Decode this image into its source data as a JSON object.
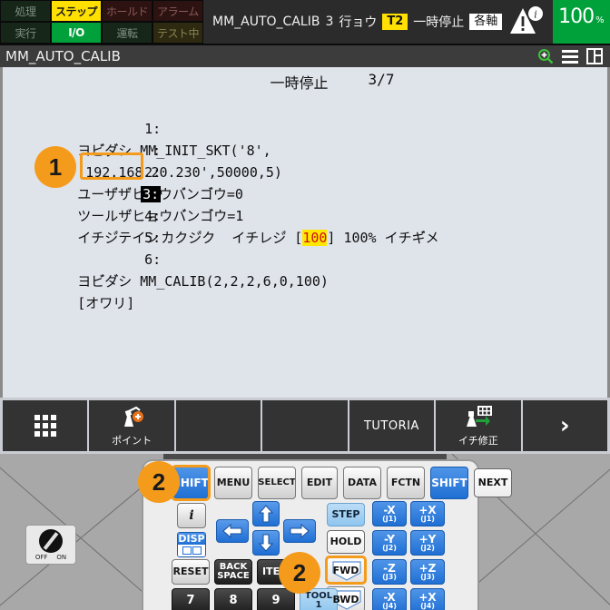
{
  "status_lights": [
    {
      "label": "処理",
      "state": "dim-green"
    },
    {
      "label": "ステップ",
      "state": "on-yellow"
    },
    {
      "label": "ホールド",
      "state": "dim-red"
    },
    {
      "label": "アラーム",
      "state": "dim-red"
    },
    {
      "label": "実行",
      "state": "dim-green"
    },
    {
      "label": "I/O",
      "state": "on-green"
    },
    {
      "label": "運転",
      "state": "dim-green"
    },
    {
      "label": "テスト中",
      "state": "dim-olive"
    }
  ],
  "statusbar": {
    "program_name": "MM_AUTO_CALIB",
    "line_number": "3",
    "line_unit": "行ョウ",
    "mode_tag": "T2",
    "run_state": "一時停止",
    "motion_type": "各軸",
    "warning_icon": "warning-info-icon",
    "override_value": "100",
    "override_unit": "%"
  },
  "titlebar": {
    "title": "MM_AUTO_CALIB",
    "icons": [
      "zoom-in-icon",
      "hamburger-menu-icon",
      "split-view-icon"
    ]
  },
  "program": {
    "run_state": "一時停止",
    "page_indicator": "3/7",
    "lines": [
      {
        "no": "1:",
        "text": "ヨビ゙ダ゙シ MM_INIT_SKT('8',"
      },
      {
        "no": ":",
        "text": "'192.168.20.230',50000,5)"
      },
      {
        "no": "2:",
        "text": "ユーザ゙ザ゙ヒョウバ゙ンゴ゙ウ=0"
      },
      {
        "no": "3:",
        "text": "ツールザ゙ヒョウバ゙ンゴ゙ウ=1",
        "selected": true
      },
      {
        "no": "4:",
        "text": "イチジ゙テイシ"
      },
      {
        "no": "5:",
        "text": "カクジ゙ク  イチレジ゙ [100] 100% イチギ゙メ",
        "highlight_value": "100"
      },
      {
        "no": "6:",
        "text": "ヨビ゙ダ゙シ MM_CALIB(2,2,2,6,0,100)"
      },
      {
        "no": "",
        "text": "[オワリ]"
      }
    ]
  },
  "toolbar": [
    {
      "icon": "grid-dots-icon",
      "label": ""
    },
    {
      "icon": "robot-point-icon",
      "label": "ポイント"
    },
    {
      "icon": "",
      "label": ""
    },
    {
      "icon": "",
      "label": ""
    },
    {
      "icon": "",
      "label": "TUTORIA"
    },
    {
      "icon": "robot-touchup-icon",
      "label": "イチ修正"
    },
    {
      "icon": "chevron-right-icon",
      "label": ""
    }
  ],
  "pendant": {
    "power_switch": {
      "off": "OFF",
      "on": "ON"
    },
    "row_top": [
      {
        "label": "SHIFT",
        "style": "k-blue",
        "highlight": true
      },
      {
        "label": "MENU",
        "style": "k-grey"
      },
      {
        "label": "SELECT",
        "style": "k-grey"
      },
      {
        "label": "EDIT",
        "style": "k-grey"
      },
      {
        "label": "DATA",
        "style": "k-grey"
      },
      {
        "label": "FCTN",
        "style": "k-grey"
      },
      {
        "label": "SHIFT",
        "style": "k-blue"
      },
      {
        "label": "NEXT",
        "style": "k-white"
      }
    ],
    "info_key": "i",
    "disp_key": "DISP",
    "step_key": "STEP",
    "hold_key": "HOLD",
    "reset_key": "RESET",
    "backspace_key": "BACK SPACE",
    "item_key": "ITEM",
    "tool_key": {
      "line1": "TOOL",
      "line2": "1"
    },
    "fwd_key": "FWD",
    "bwd_key": "BWD",
    "numpad": [
      "7",
      "8",
      "9"
    ],
    "jog_keys": [
      {
        "label": "-X",
        "axis": "(J1)"
      },
      {
        "label": "+X",
        "axis": "(J1)"
      },
      {
        "label": "-Y",
        "axis": "(J2)"
      },
      {
        "label": "+Y",
        "axis": "(J2)"
      },
      {
        "label": "-Z",
        "axis": "(J3)"
      },
      {
        "label": "+Z",
        "axis": "(J3)"
      },
      {
        "label": "-X",
        "axis": "(J4)"
      },
      {
        "label": "+X",
        "axis": "(J4)"
      }
    ]
  },
  "annotations": [
    {
      "number": "1",
      "target": "program-line-3"
    },
    {
      "number": "2",
      "target": "shift-key"
    },
    {
      "number": "2",
      "target": "fwd-key"
    }
  ],
  "colors": {
    "accent_orange": "#f59b1c",
    "status_green": "#00a13a",
    "status_yellow": "#ffe000",
    "key_blue": "#1f6fd4",
    "program_bg": "#dfe3ea"
  }
}
